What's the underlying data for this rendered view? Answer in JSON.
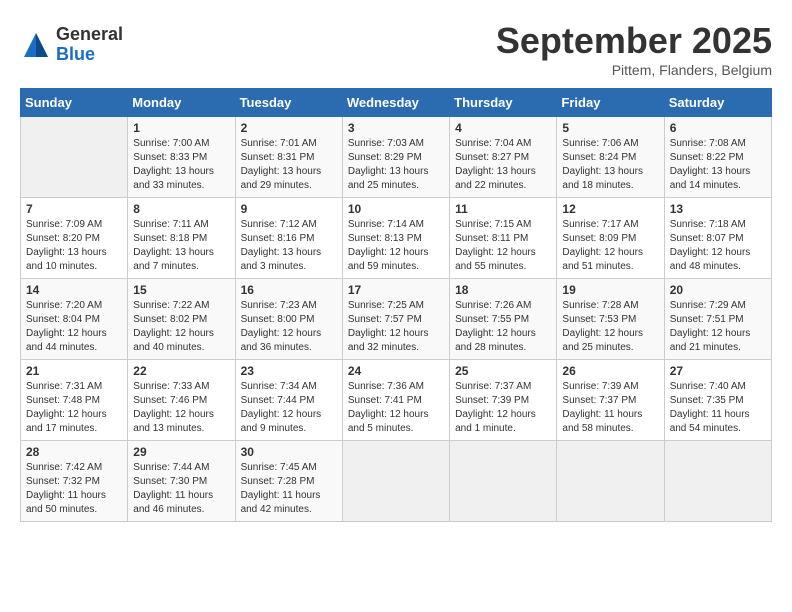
{
  "logo": {
    "general": "General",
    "blue": "Blue"
  },
  "title": "September 2025",
  "subtitle": "Pittem, Flanders, Belgium",
  "days_of_week": [
    "Sunday",
    "Monday",
    "Tuesday",
    "Wednesday",
    "Thursday",
    "Friday",
    "Saturday"
  ],
  "weeks": [
    [
      {
        "day": "",
        "info": ""
      },
      {
        "day": "1",
        "info": "Sunrise: 7:00 AM\nSunset: 8:33 PM\nDaylight: 13 hours\nand 33 minutes."
      },
      {
        "day": "2",
        "info": "Sunrise: 7:01 AM\nSunset: 8:31 PM\nDaylight: 13 hours\nand 29 minutes."
      },
      {
        "day": "3",
        "info": "Sunrise: 7:03 AM\nSunset: 8:29 PM\nDaylight: 13 hours\nand 25 minutes."
      },
      {
        "day": "4",
        "info": "Sunrise: 7:04 AM\nSunset: 8:27 PM\nDaylight: 13 hours\nand 22 minutes."
      },
      {
        "day": "5",
        "info": "Sunrise: 7:06 AM\nSunset: 8:24 PM\nDaylight: 13 hours\nand 18 minutes."
      },
      {
        "day": "6",
        "info": "Sunrise: 7:08 AM\nSunset: 8:22 PM\nDaylight: 13 hours\nand 14 minutes."
      }
    ],
    [
      {
        "day": "7",
        "info": "Sunrise: 7:09 AM\nSunset: 8:20 PM\nDaylight: 13 hours\nand 10 minutes."
      },
      {
        "day": "8",
        "info": "Sunrise: 7:11 AM\nSunset: 8:18 PM\nDaylight: 13 hours\nand 7 minutes."
      },
      {
        "day": "9",
        "info": "Sunrise: 7:12 AM\nSunset: 8:16 PM\nDaylight: 13 hours\nand 3 minutes."
      },
      {
        "day": "10",
        "info": "Sunrise: 7:14 AM\nSunset: 8:13 PM\nDaylight: 12 hours\nand 59 minutes."
      },
      {
        "day": "11",
        "info": "Sunrise: 7:15 AM\nSunset: 8:11 PM\nDaylight: 12 hours\nand 55 minutes."
      },
      {
        "day": "12",
        "info": "Sunrise: 7:17 AM\nSunset: 8:09 PM\nDaylight: 12 hours\nand 51 minutes."
      },
      {
        "day": "13",
        "info": "Sunrise: 7:18 AM\nSunset: 8:07 PM\nDaylight: 12 hours\nand 48 minutes."
      }
    ],
    [
      {
        "day": "14",
        "info": "Sunrise: 7:20 AM\nSunset: 8:04 PM\nDaylight: 12 hours\nand 44 minutes."
      },
      {
        "day": "15",
        "info": "Sunrise: 7:22 AM\nSunset: 8:02 PM\nDaylight: 12 hours\nand 40 minutes."
      },
      {
        "day": "16",
        "info": "Sunrise: 7:23 AM\nSunset: 8:00 PM\nDaylight: 12 hours\nand 36 minutes."
      },
      {
        "day": "17",
        "info": "Sunrise: 7:25 AM\nSunset: 7:57 PM\nDaylight: 12 hours\nand 32 minutes."
      },
      {
        "day": "18",
        "info": "Sunrise: 7:26 AM\nSunset: 7:55 PM\nDaylight: 12 hours\nand 28 minutes."
      },
      {
        "day": "19",
        "info": "Sunrise: 7:28 AM\nSunset: 7:53 PM\nDaylight: 12 hours\nand 25 minutes."
      },
      {
        "day": "20",
        "info": "Sunrise: 7:29 AM\nSunset: 7:51 PM\nDaylight: 12 hours\nand 21 minutes."
      }
    ],
    [
      {
        "day": "21",
        "info": "Sunrise: 7:31 AM\nSunset: 7:48 PM\nDaylight: 12 hours\nand 17 minutes."
      },
      {
        "day": "22",
        "info": "Sunrise: 7:33 AM\nSunset: 7:46 PM\nDaylight: 12 hours\nand 13 minutes."
      },
      {
        "day": "23",
        "info": "Sunrise: 7:34 AM\nSunset: 7:44 PM\nDaylight: 12 hours\nand 9 minutes."
      },
      {
        "day": "24",
        "info": "Sunrise: 7:36 AM\nSunset: 7:41 PM\nDaylight: 12 hours\nand 5 minutes."
      },
      {
        "day": "25",
        "info": "Sunrise: 7:37 AM\nSunset: 7:39 PM\nDaylight: 12 hours\nand 1 minute."
      },
      {
        "day": "26",
        "info": "Sunrise: 7:39 AM\nSunset: 7:37 PM\nDaylight: 11 hours\nand 58 minutes."
      },
      {
        "day": "27",
        "info": "Sunrise: 7:40 AM\nSunset: 7:35 PM\nDaylight: 11 hours\nand 54 minutes."
      }
    ],
    [
      {
        "day": "28",
        "info": "Sunrise: 7:42 AM\nSunset: 7:32 PM\nDaylight: 11 hours\nand 50 minutes."
      },
      {
        "day": "29",
        "info": "Sunrise: 7:44 AM\nSunset: 7:30 PM\nDaylight: 11 hours\nand 46 minutes."
      },
      {
        "day": "30",
        "info": "Sunrise: 7:45 AM\nSunset: 7:28 PM\nDaylight: 11 hours\nand 42 minutes."
      },
      {
        "day": "",
        "info": ""
      },
      {
        "day": "",
        "info": ""
      },
      {
        "day": "",
        "info": ""
      },
      {
        "day": "",
        "info": ""
      }
    ]
  ]
}
